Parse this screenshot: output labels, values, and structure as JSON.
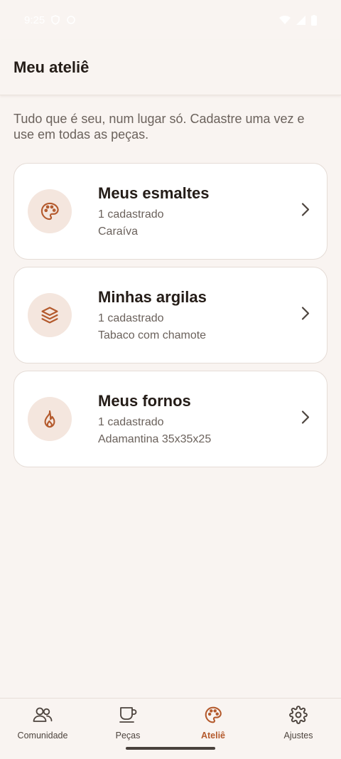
{
  "status_bar": {
    "time": "9:25"
  },
  "header": {
    "title": "Meu ateliê"
  },
  "intro": "Tudo que é seu, num lugar só. Cadastre uma vez e use em todas as peças.",
  "cards": [
    {
      "title": "Meus esmaltes",
      "count": "1 cadastrado",
      "subtitle": "Caraíva",
      "icon": "palette-icon"
    },
    {
      "title": "Minhas argilas",
      "count": "1 cadastrado",
      "subtitle": "Tabaco com chamote",
      "icon": "layers-icon"
    },
    {
      "title": "Meus fornos",
      "count": "1 cadastrado",
      "subtitle": "Adamantina 35x35x25",
      "icon": "flame-icon"
    }
  ],
  "bottom_nav": {
    "items": [
      {
        "label": "Comunidade",
        "icon": "users-icon",
        "active": false
      },
      {
        "label": "Peças",
        "icon": "cup-icon",
        "active": false
      },
      {
        "label": "Ateliê",
        "icon": "palette-icon",
        "active": true
      },
      {
        "label": "Ajustes",
        "icon": "gear-icon",
        "active": false
      }
    ]
  },
  "colors": {
    "background": "#f9f4f1",
    "accent": "#b45a2d",
    "icon_circle": "#f4e6de",
    "card": "#ffffff",
    "text": "#241c17",
    "muted_text": "#6b625c"
  }
}
